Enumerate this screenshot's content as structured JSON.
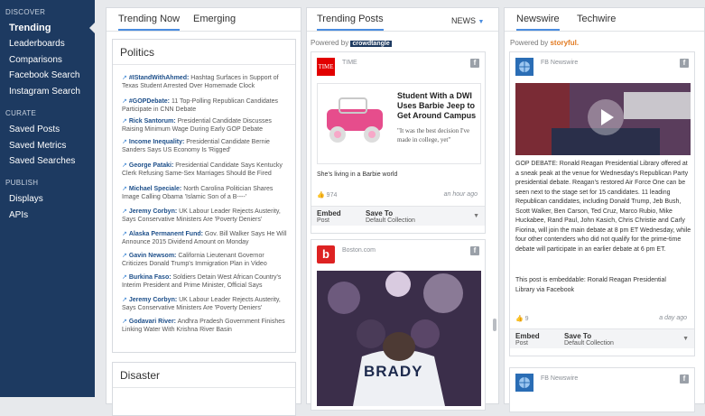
{
  "sidebar": {
    "discover_label": "DISCOVER",
    "discover_items": [
      "Trending",
      "Leaderboards",
      "Comparisons",
      "Facebook Search",
      "Instagram Search"
    ],
    "curate_label": "CURATE",
    "curate_items": [
      "Saved Posts",
      "Saved Metrics",
      "Saved Searches"
    ],
    "publish_label": "PUBLISH",
    "publish_items": [
      "Displays",
      "APIs"
    ]
  },
  "col1": {
    "tabs": [
      "Trending Now",
      "Emerging"
    ],
    "box_title": "Politics",
    "trends": [
      {
        "name": "#IStandWithAhmed:",
        "text": "Hashtag Surfaces in Support of Texas Student Arrested Over Homemade Clock"
      },
      {
        "name": "#GOPDebate:",
        "text": "11 Top-Polling Republican Candidates Participate in CNN Debate"
      },
      {
        "name": "Rick Santorum:",
        "text": "Presidential Candidate Discusses Raising Minimum Wage During Early GOP Debate"
      },
      {
        "name": "Income Inequality:",
        "text": "Presidential Candidate Bernie Sanders Says US Economy Is 'Rigged'"
      },
      {
        "name": "George Pataki:",
        "text": "Presidential Candidate Says Kentucky Clerk Refusing Same-Sex Marriages Should Be Fired"
      },
      {
        "name": "Michael Speciale:",
        "text": "North Carolina Politician Shares Image Calling Obama 'Islamic Son of a B----'"
      },
      {
        "name": "Jeremy Corbyn:",
        "text": "UK Labour Leader Rejects Austerity, Says Conservative Ministers Are 'Poverty Deniers'"
      },
      {
        "name": "Alaska Permanent Fund:",
        "text": "Gov. Bill Walker Says He Will Announce 2015 Dividend Amount on Monday"
      },
      {
        "name": "Gavin Newsom:",
        "text": "California Lieutenant Governor Criticizes Donald Trump's Immigration Plan in Video"
      },
      {
        "name": "Burkina Faso:",
        "text": "Soldiers Detain West African Country's Interim President and Prime Minister, Official Says"
      },
      {
        "name": "Jeremy Corbyn:",
        "text": "UK Labour Leader Rejects Austerity, Says Conservative Ministers Are 'Poverty Deniers'"
      },
      {
        "name": "Godavari River:",
        "text": "Andhra Pradesh Government Finishes Linking Water With Krishna River Basin"
      }
    ],
    "box2_title": "Disaster"
  },
  "col2": {
    "tab": "Trending Posts",
    "dropdown": "NEWS",
    "powered_by": "Powered by",
    "powered_brand": "crowdtangle",
    "post1": {
      "logo": "TIME",
      "source": "TIME",
      "headline": "Student With a DWI Uses Barbie Jeep to Get Around Campus",
      "quote": "\"It was the best decision I've made in college, yet\"",
      "caption": "She's living in a Barbie world",
      "count": "974",
      "time": "an hour ago"
    },
    "embed": "Embed",
    "embed_sub": "Post",
    "save": "Save To",
    "save_sub": "Default Collection",
    "post2": {
      "source": "Boston.com",
      "jersey": "BRADY"
    }
  },
  "col3": {
    "tabs": [
      "Newswire",
      "Techwire"
    ],
    "powered_by": "Powered by",
    "powered_brand": "storyful.",
    "post1": {
      "source": "FB Newswire",
      "body": "GOP DEBATE: Ronald Reagan Presidential Library offered at a sneak peak at the venue for Wednesday's Republican Party presidential debate. Reagan's restored Air Force One can be seen next to the stage set for 15 candidates. 11 leading Republican candidates, including Donald Trump, Jeb Bush, Scott Walker, Ben Carson, Ted Cruz, Marco Rubio, Mike Huckabee, Rand Paul, John Kasich, Chris Christie and Carly Fiorina, will join the main debate at 8 pm ET Wednesday, while four other contenders who did not qualify for the prime-time debate will participate in an earlier debate at 6 pm ET.",
      "embed_note": "This post is embeddable: Ronald Reagan Presidential Library via Facebook",
      "count": "9",
      "time": "a day ago"
    },
    "post2": {
      "source": "FB Newswire"
    }
  }
}
